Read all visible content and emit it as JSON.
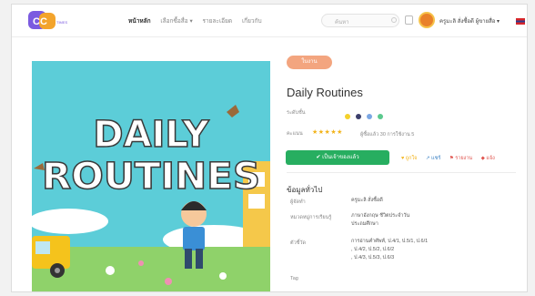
{
  "nav": {
    "logo_text": "CC",
    "logo_sub": "TIMES",
    "links": [
      "หน้าหลัก",
      "เลือกซื้อสื่อ ▾",
      "รายละเอียด",
      "เกี่ยวกับ"
    ],
    "search_placeholder": "ค้นหา",
    "username": "ครูมะลิ สั่งซื้อดี ผู้ขายสื่อ ▾"
  },
  "product": {
    "badge": "ใบงาน",
    "title": "Daily Routines",
    "grade_label": "ระดับชั้น",
    "grade_dot_colors": [
      "#f4d12b",
      "#3b3f6b",
      "#7ba7e3",
      "#5bc98d"
    ],
    "rating_label": "คะแนน",
    "stars": "★★★★★",
    "downloads": "ผู้ซื้อแล้ว 30   การใช้งาน 5",
    "primary_button": "✔ เป็นเจ้าของแล้ว",
    "actions": [
      {
        "label": "♥ ถูกใจ",
        "color": "#f2b31a"
      },
      {
        "label": "↗ แชร์",
        "color": "#3b82c4"
      },
      {
        "label": "⚑ รายงาน",
        "color": "#e0554f"
      },
      {
        "label": "◆ แจ้ง",
        "color": "#e0554f"
      }
    ]
  },
  "info": {
    "heading": "ข้อมูลทั่วไป",
    "rows": [
      {
        "label": "ผู้จัดทำ",
        "lines": [
          "ครูมะลิ สั่งซื้อดี"
        ]
      },
      {
        "label": "หมวดหมู่การเรียนรู้",
        "lines": [
          "ภาษาอังกฤษ ชีวิตประจำวัน",
          "ประถมศึกษา"
        ]
      },
      {
        "label": "ตัวชี้วัด",
        "lines": [
          "การอ่านคำศัพท์, ป.4/1, ป.5/1, ป.6/1",
          ", ป.4/2, ป.5/2, ป.6/2",
          ", ป.4/3, ป.5/3, ป.6/3"
        ]
      },
      {
        "label": "Tag",
        "lines": [
          ""
        ]
      }
    ]
  },
  "cover": {
    "line1": "DAILY",
    "line2": "ROUTINES"
  }
}
